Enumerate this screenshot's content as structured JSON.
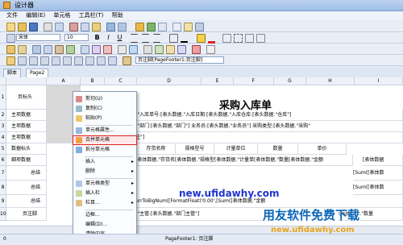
{
  "window": {
    "title": "设计器"
  },
  "menu": [
    "文件",
    "编辑(E)",
    "单元格",
    "工具栏(T)",
    "帮助"
  ],
  "toolbar": {
    "font_name": "宋体",
    "font_size": "10",
    "page_footer": "页注脚[PageFooter1:页注脚]"
  },
  "tabs": [
    "脚本",
    "Page2"
  ],
  "columns": [
    "A",
    "B",
    "C",
    "D",
    "E",
    "F",
    "G",
    "H",
    "I"
  ],
  "rows": [
    {
      "num": "1",
      "label": "页标头"
    },
    {
      "num": "2",
      "label": "主项数据"
    },
    {
      "num": "3",
      "label": "主项数据"
    },
    {
      "num": "4",
      "label": "主项数据"
    },
    {
      "num": "5",
      "label": "数据标头"
    },
    {
      "num": "6",
      "label": "细项数据"
    },
    {
      "num": "7",
      "label": "总结"
    },
    {
      "num": "8",
      "label": "总结"
    },
    {
      "num": "9",
      "label": "总结"
    },
    {
      "num": "10",
      "label": "页注脚"
    }
  ],
  "report_title": "采购入库单",
  "cells": {
    "r2": "[\"入库单号:[表头数据.\"入库日期:[表头数据.\"入库仓库:[表头数据.\"仓库\"]",
    "r3": "[\"部门:[表头数据.\"部门\"]  业务员:[表头数据.\"业务员\"]  采购类型:[表头数据.\"采购\"",
    "r4": "注\"]",
    "r5": [
      "存货名称",
      "规格型号",
      "计量单位",
      "数量",
      "单价"
    ],
    "r6": "[表体数据.\"存货名[表体数据.\"规格型[表体数据.\"计量单[表体数据.\"数量[表体数据.\"金额",
    "r6_right": "[表体数据",
    "r7_right": "[Sum([表体数",
    "r8_right": "[Sum([表体数",
    "r9": "urrToBigNum([FormatFloat('0.00',[Sum([表体数据.\"金额",
    "r10_left": "[\"主管:[表头数据.\"部门主管\"]",
    "r10_right": "(表体数据.\"数量"
  },
  "context_menu": [
    {
      "label": "剪切(U)",
      "icon": "cut-icon",
      "arrow": false
    },
    {
      "label": "复制(C)",
      "icon": "copy-icon",
      "arrow": false
    },
    {
      "label": "粘贴(P)",
      "icon": "paste-icon",
      "arrow": false
    },
    {
      "label": "单元格属性...",
      "icon": "cell-props-icon",
      "arrow": false
    },
    {
      "label": "合并单元格",
      "icon": "merge-cells-icon",
      "arrow": false,
      "highlight": true
    },
    {
      "label": "拆分单元格",
      "icon": "split-cells-icon",
      "arrow": false
    },
    {
      "label": "插入",
      "icon": "",
      "arrow": true
    },
    {
      "label": "删除",
      "icon": "",
      "arrow": true
    },
    {
      "label": "单元格类型",
      "icon": "cell-type-icon",
      "arrow": true
    },
    {
      "label": "插入栏",
      "icon": "insert-band-icon",
      "arrow": true
    },
    {
      "label": "栏目...",
      "icon": "band-icon",
      "arrow": true
    },
    {
      "label": "边框...",
      "icon": "",
      "arrow": false
    },
    {
      "label": "编辑(D)...",
      "icon": "",
      "arrow": false
    },
    {
      "label": "清除内容",
      "icon": "",
      "arrow": false
    }
  ],
  "status": {
    "left": "0",
    "page_footer": "PageFooter1: 页注脚"
  },
  "watermarks": {
    "url_blue": "new.ufidawhy.com",
    "brand": "用友软件免费下载",
    "url_orange": "new.ufidawhy.com"
  }
}
